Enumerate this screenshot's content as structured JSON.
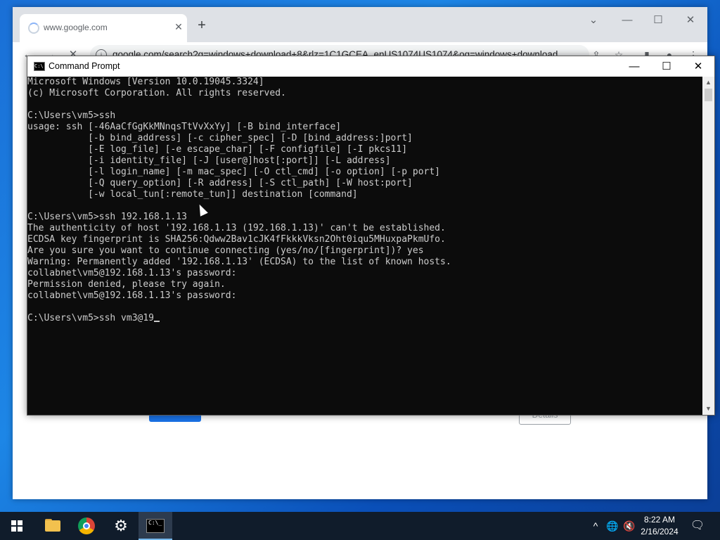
{
  "browser": {
    "tab_title": "www.google.com",
    "url": "google.com/search?q=windows+download+8&rlz=1C1GCEA_enUS1074US1074&oq=windows+download...",
    "page_button_label": "Details"
  },
  "cmd": {
    "title": "Command Prompt",
    "lines": [
      "Microsoft Windows [Version 10.0.19045.3324]",
      "(c) Microsoft Corporation. All rights reserved.",
      "",
      "C:\\Users\\vm5>ssh",
      "usage: ssh [-46AaCfGgKkMNnqsTtVvXxYy] [-B bind_interface]",
      "           [-b bind_address] [-c cipher_spec] [-D [bind_address:]port]",
      "           [-E log_file] [-e escape_char] [-F configfile] [-I pkcs11]",
      "           [-i identity_file] [-J [user@]host[:port]] [-L address]",
      "           [-l login_name] [-m mac_spec] [-O ctl_cmd] [-o option] [-p port]",
      "           [-Q query_option] [-R address] [-S ctl_path] [-W host:port]",
      "           [-w local_tun[:remote_tun]] destination [command]",
      "",
      "C:\\Users\\vm5>ssh 192.168.1.13",
      "The authenticity of host '192.168.1.13 (192.168.1.13)' can't be established.",
      "ECDSA key fingerprint is SHA256:Qdww2Bav1cJK4fFkkkVksn2Oht0iqu5MHuxpaPkmUfo.",
      "Are you sure you want to continue connecting (yes/no/[fingerprint])? yes",
      "Warning: Permanently added '192.168.1.13' (ECDSA) to the list of known hosts.",
      "collabnet\\vm5@192.168.1.13's password:",
      "Permission denied, please try again.",
      "collabnet\\vm5@192.168.1.13's password:",
      "",
      "C:\\Users\\vm5>ssh vm3@19"
    ]
  },
  "taskbar": {
    "time": "8:22 AM",
    "date": "2/16/2024"
  },
  "colors": {
    "console_bg": "#0c0c0c",
    "console_text": "#cccccc",
    "taskbar_bg": "#101c2b",
    "accent_blue": "#1a73e8"
  }
}
